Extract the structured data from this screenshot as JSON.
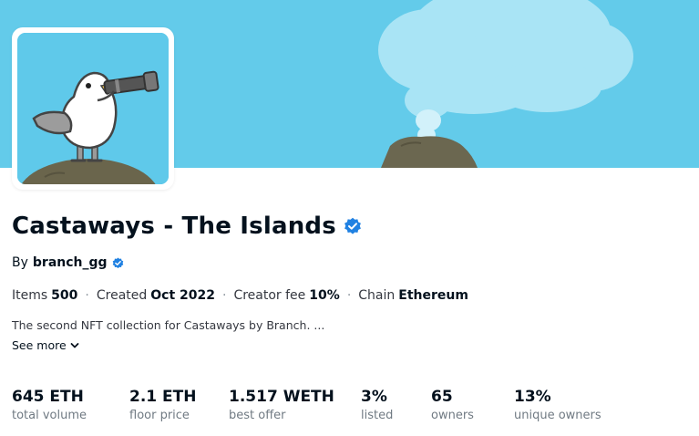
{
  "collection": {
    "title": "Castaways - The Islands",
    "creator_prefix": "By",
    "creator_name": "branch_gg",
    "verified_icon": "verified-badge-icon",
    "description": "The second NFT collection for Castaways by Branch. ...",
    "see_more_label": "See more",
    "meta": [
      {
        "label": "Items",
        "value": "500"
      },
      {
        "label": "Created",
        "value": "Oct 2022"
      },
      {
        "label": "Creator fee",
        "value": "10%"
      },
      {
        "label": "Chain",
        "value": "Ethereum"
      }
    ],
    "separator": "·"
  },
  "stats": [
    {
      "value": "645 ETH",
      "label": "total volume"
    },
    {
      "value": "2.1 ETH",
      "label": "floor price"
    },
    {
      "value": "1.517 WETH",
      "label": "best offer"
    },
    {
      "value": "3%",
      "label": "listed"
    },
    {
      "value": "65",
      "label": "owners"
    },
    {
      "value": "13%",
      "label": "unique owners"
    }
  ],
  "colors": {
    "banner_sky": "#63cbea",
    "cloud": "#a9e4f5",
    "rock": "#6b6750",
    "verified_blue": "#2081e2",
    "text_primary": "#04111d",
    "text_secondary": "#707a83"
  }
}
